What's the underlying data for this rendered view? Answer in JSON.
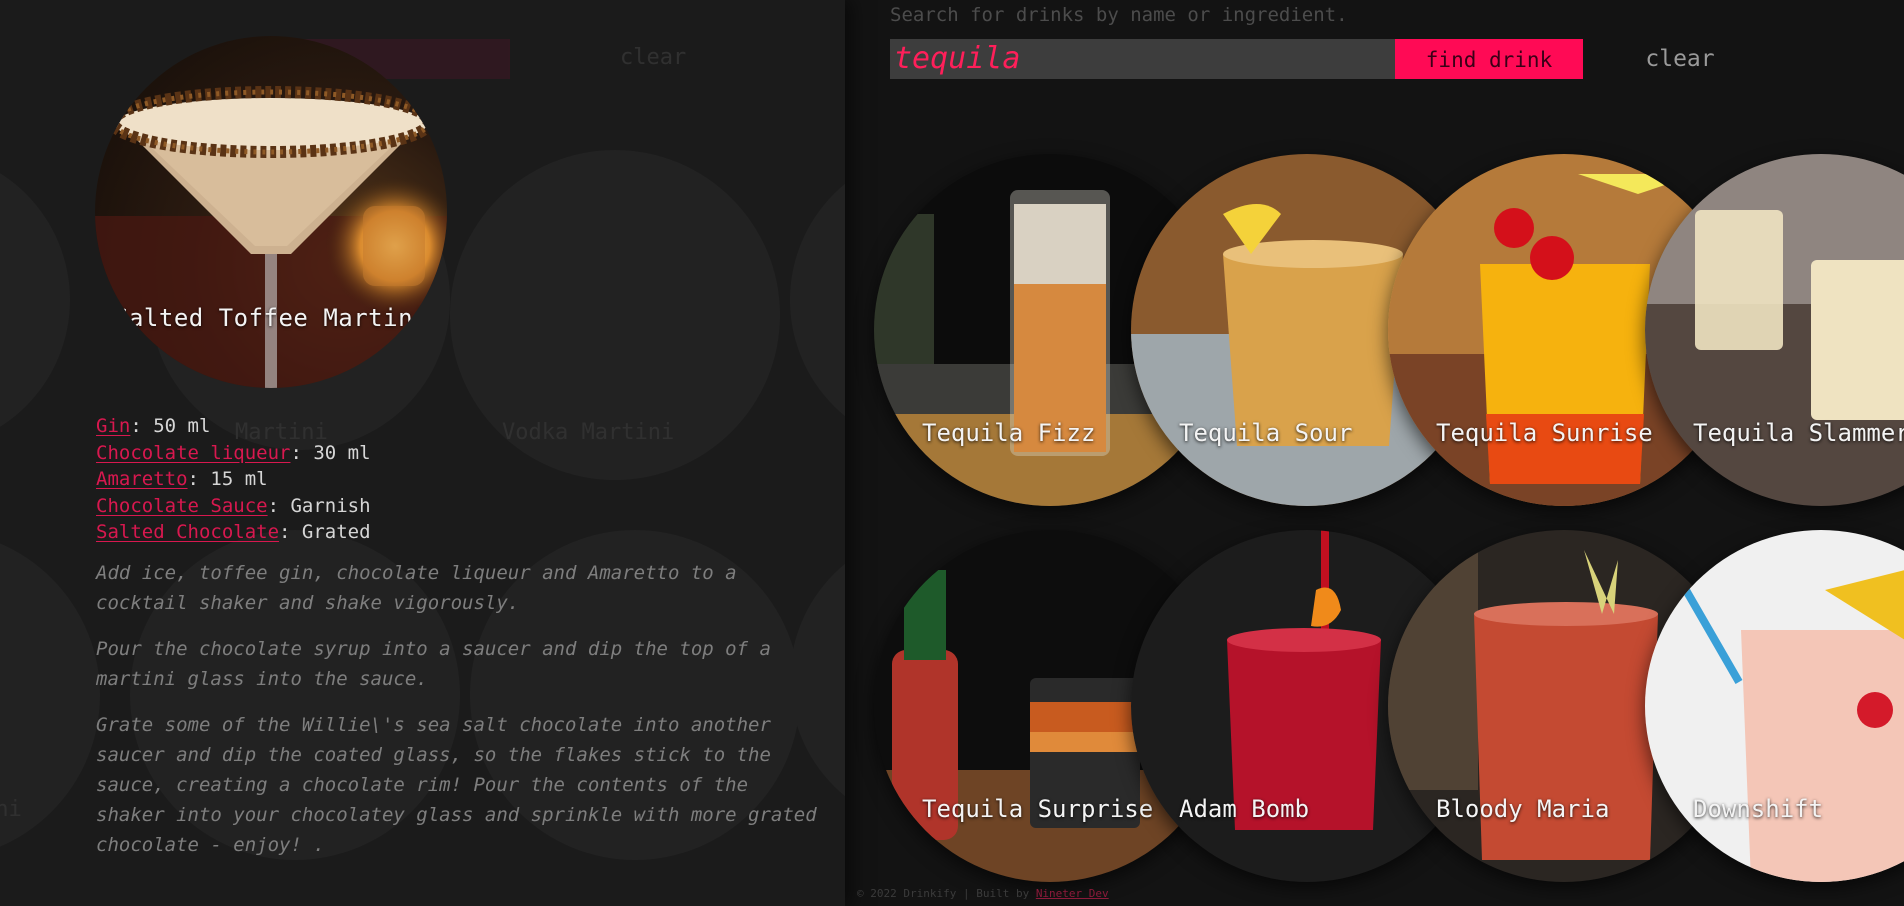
{
  "search": {
    "hint": "Search for drinks by name or ingredient.",
    "value": "tequila",
    "find_label": "find drink",
    "clear_label": "clear"
  },
  "detail": {
    "title": "Salted Toffee Martini",
    "ingredients": [
      {
        "name": "Gin",
        "amount": ": 50 ml"
      },
      {
        "name": "Chocolate liqueur",
        "amount": ": 30 ml"
      },
      {
        "name": "Amaretto",
        "amount": ": 15 ml"
      },
      {
        "name": "Chocolate Sauce",
        "amount": ": Garnish"
      },
      {
        "name": "Salted Chocolate",
        "amount": ": Grated"
      }
    ],
    "instructions": [
      "Add ice, toffee gin, chocolate liqueur and Amaretto to a\ncocktail shaker and shake vigorously.",
      "Pour the chocolate syrup into a saucer and dip the top of a\nmartini glass into the sauce.",
      "Grate some of the Willie\\'s sea salt chocolate into another\nsaucer and dip the coated glass, so the flakes stick to the\nsauce, creating a chocolate rim! Pour the contents of the\nshaker into your chocolatey glass and sprinkle with more grated\nchocolate - enjoy! ."
    ]
  },
  "ghost": {
    "clear_label": "clear",
    "martini_label": "Martini",
    "vodka_martini_label": "Vodka Martini",
    "tini_label": "ini"
  },
  "results": [
    {
      "name": "Tequila Fizz",
      "colors": [
        "#0c0c0c",
        "#d6893f",
        "#3b3b38"
      ]
    },
    {
      "name": "Tequila Sour",
      "colors": [
        "#8a5a2e",
        "#d9a24b",
        "#9ea6aa"
      ]
    },
    {
      "name": "Tequila Sunrise",
      "colors": [
        "#b57a3a",
        "#f6b20e",
        "#7a4326"
      ]
    },
    {
      "name": "Tequila Slammer",
      "colors": [
        "#c9c4c0",
        "#efe3c1",
        "#544740"
      ]
    },
    {
      "name": "Tequila Surprise",
      "colors": [
        "#0d0d0d",
        "#c85b1f",
        "#6e4425"
      ]
    },
    {
      "name": "Adam Bomb",
      "colors": [
        "#1c1c1c",
        "#b5122a",
        "#2a2a2a"
      ]
    },
    {
      "name": "Bloody Maria",
      "colors": [
        "#2b2622",
        "#c44a32",
        "#3b3734"
      ]
    },
    {
      "name": "Downshift",
      "colors": [
        "#f0f0f0",
        "#f4c1b0",
        "#e8e5e0"
      ]
    }
  ],
  "footer": {
    "text": "© 2022 Drinkify | Built by ",
    "link": "Nineter Dev"
  },
  "colors": {
    "accent": "#ff0a55",
    "link": "#d8184f",
    "background": "#131313",
    "panel": "#1b1b1b"
  }
}
